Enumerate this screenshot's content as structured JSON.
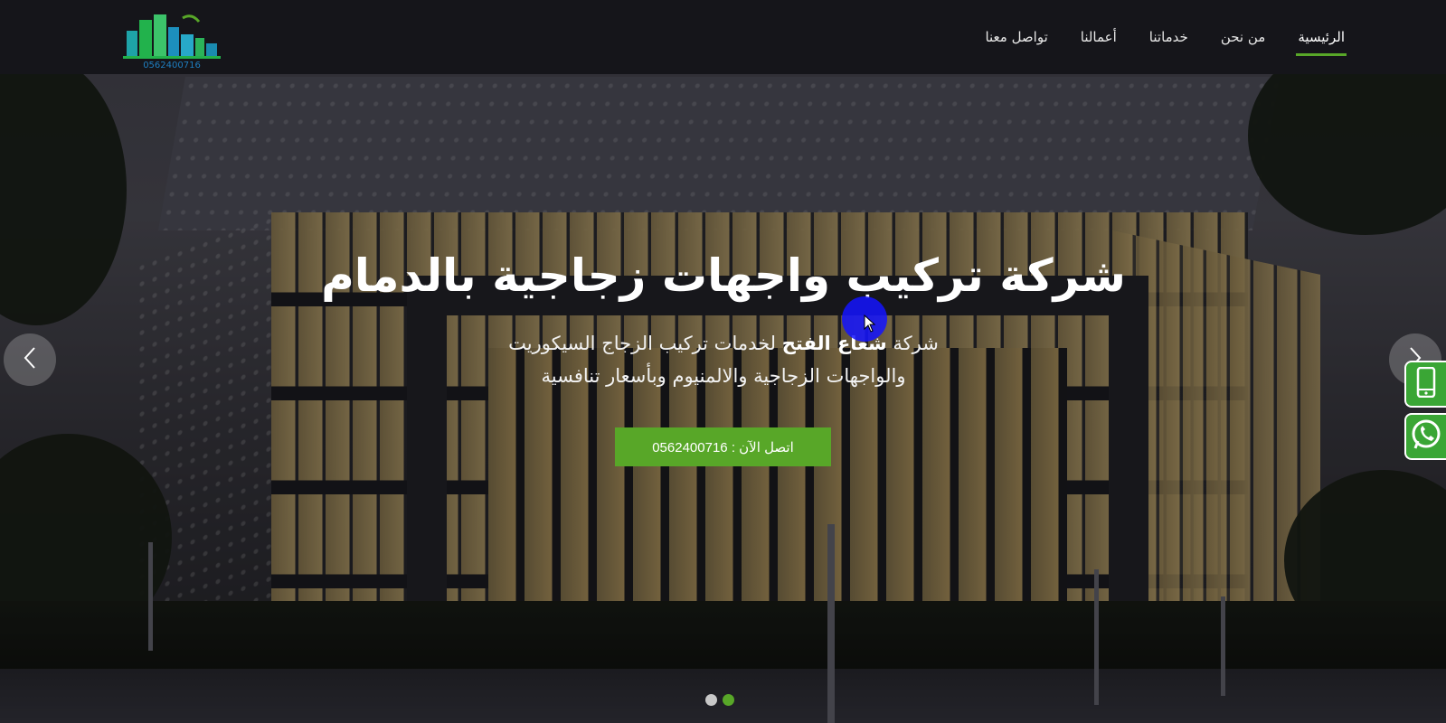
{
  "header": {
    "logo_phone": "0562400716",
    "nav": [
      {
        "label": "الرئيسية",
        "active": true
      },
      {
        "label": "من نحن",
        "active": false
      },
      {
        "label": "خدماتنا",
        "active": false
      },
      {
        "label": "أعمالنا",
        "active": false
      },
      {
        "label": "تواصل معنا",
        "active": false
      }
    ]
  },
  "hero": {
    "title": "شركة تركيب واجهات زجاجية بالدمام",
    "subtitle_prefix": "شركة ",
    "subtitle_brand": "شعاع الفتح",
    "subtitle_line1_rest": " لخدمات تركيب الزجاج السيكوريت",
    "subtitle_line2": "والواجهات الزجاجية والالمنيوم وبأسعار تنافسية",
    "cta_label": "اتصل الآن : 0562400716"
  },
  "slider": {
    "prev_icon": "chevron-left-icon",
    "next_icon": "chevron-right-icon",
    "slide_count": 2,
    "active_slide": 2
  },
  "floating": {
    "phone_icon": "mobile-phone-icon",
    "whatsapp_icon": "whatsapp-icon"
  },
  "colors": {
    "accent": "#58a728",
    "header_bg": "#15151a",
    "whatsapp": "#3aa635",
    "cursor": "#1414ff"
  }
}
